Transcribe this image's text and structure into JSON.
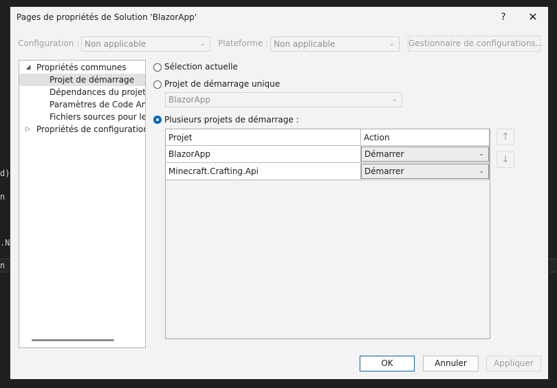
{
  "background": {
    "lines": [
      "d)",
      "n",
      ".N",
      "n"
    ]
  },
  "dialog": {
    "title": "Pages de propriétés de Solution 'BlazorApp'",
    "help": "?",
    "close": "✕"
  },
  "config_row": {
    "configuration_label": "Configuration :",
    "configuration_value": "Non applicable",
    "platform_label": "Plateforme :",
    "platform_value": "Non applicable",
    "manager_button": "Gestionnaire de configurations..."
  },
  "tree": {
    "items": [
      {
        "label": "Propriétés communes",
        "twisty": "◢"
      },
      {
        "label": "Projet de démarrage"
      },
      {
        "label": "Dépendances du projet"
      },
      {
        "label": "Paramètres de Code Analy"
      },
      {
        "label": "Fichiers sources pour le dé"
      },
      {
        "label": "Propriétés de configuration",
        "twisty": "▷"
      }
    ]
  },
  "startup": {
    "current_selection": "Sélection actuelle",
    "single_project": "Projet de démarrage unique",
    "single_project_value": "BlazorApp",
    "multiple_projects": "Plusieurs projets de démarrage :"
  },
  "grid": {
    "col_project": "Projet",
    "col_action": "Action",
    "rows": [
      {
        "project": "BlazorApp",
        "action": "Démarrer"
      },
      {
        "project": "Minecraft.Crafting.Api",
        "action": "Démarrer"
      }
    ]
  },
  "arrows": {
    "up": "↑",
    "down": "↓"
  },
  "footer": {
    "ok": "OK",
    "cancel": "Annuler",
    "apply": "Appliquer"
  },
  "colors": {
    "accent": "#0067c0",
    "dialog_bg": "#f3f3f3"
  },
  "icons": {
    "chevron": "chevron-down-icon"
  }
}
